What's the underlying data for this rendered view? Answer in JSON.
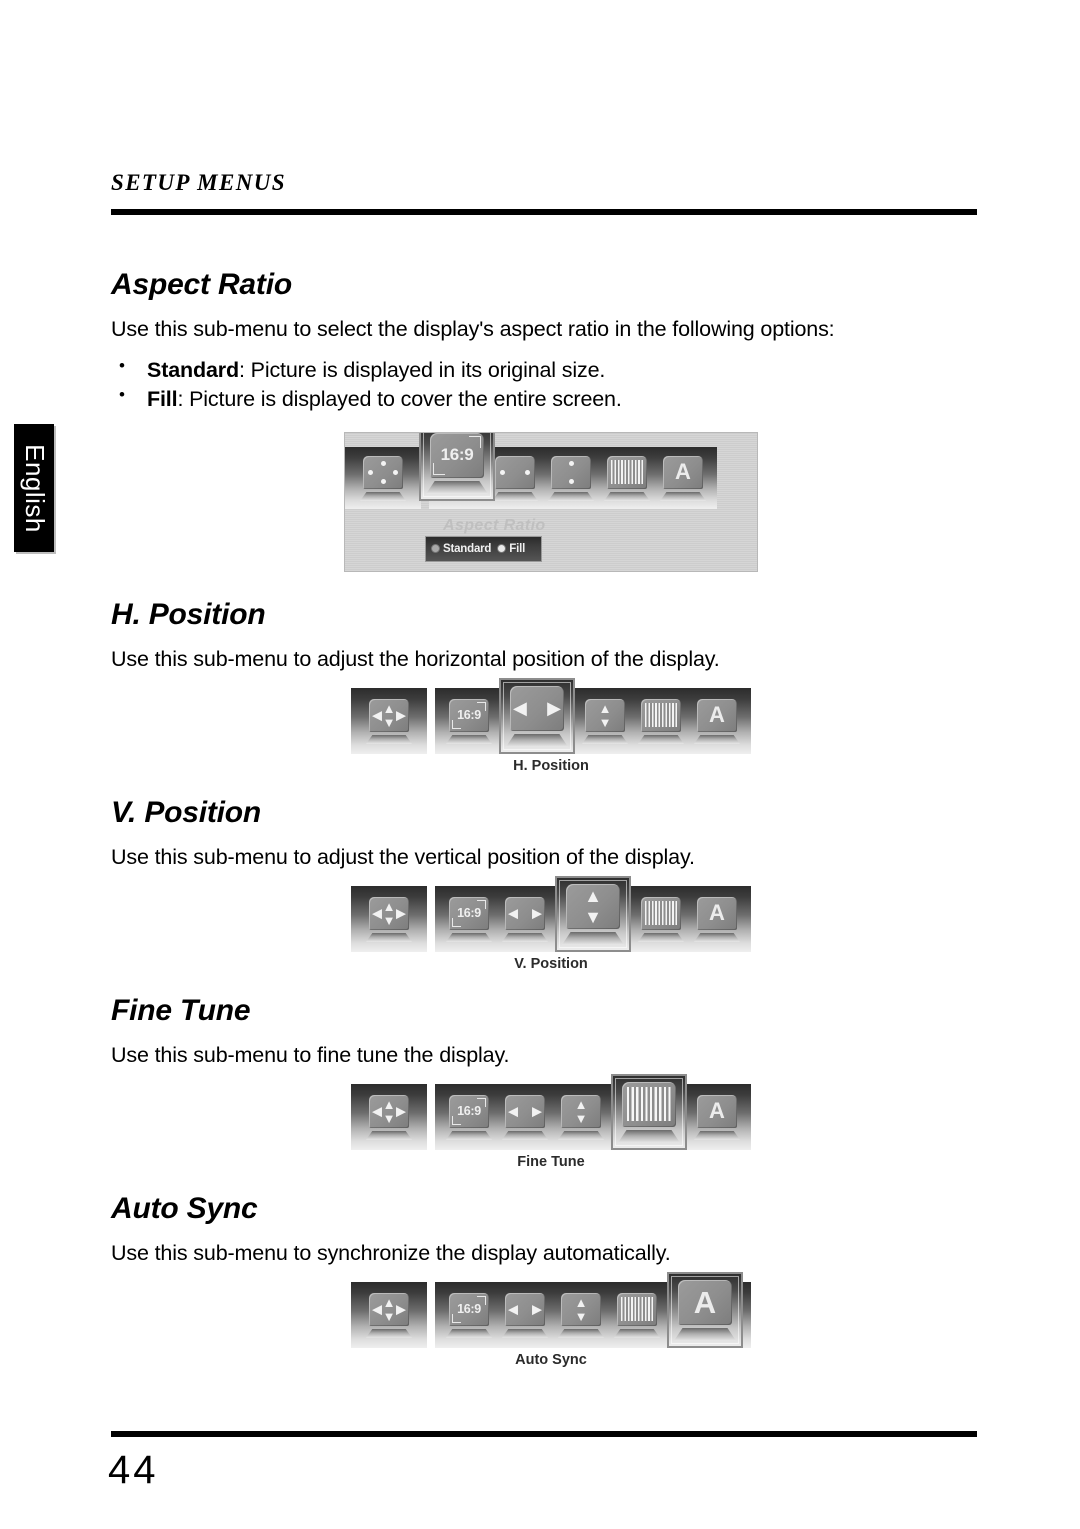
{
  "page": {
    "running_head": "SETUP MENUS",
    "page_number": "44",
    "language_tab": "English"
  },
  "sections": [
    {
      "title": "Aspect Ratio",
      "intro": "Use this sub-menu to select the display's aspect ratio in the following options:",
      "options": [
        {
          "term": "Standard",
          "desc": ": Picture is displayed in its original size."
        },
        {
          "term": "Fill",
          "desc": ": Picture is displayed to cover the entire screen."
        }
      ],
      "figure": {
        "selected": "aspect-ratio",
        "ghost_label": "Aspect Ratio",
        "radio_options": [
          {
            "label": "Standard",
            "selected": false
          },
          {
            "label": "Fill",
            "selected": true
          }
        ],
        "icons": [
          {
            "name": "four-way-arrows-icon",
            "glyph": "dots"
          },
          {
            "name": "aspect-ratio-icon",
            "glyph": "16:9"
          },
          {
            "name": "h-position-icon",
            "glyph": "left-right"
          },
          {
            "name": "v-position-icon",
            "glyph": "up-down"
          },
          {
            "name": "fine-tune-icon",
            "glyph": "bars"
          },
          {
            "name": "auto-sync-icon",
            "glyph": "A"
          }
        ]
      }
    },
    {
      "title": "H. Position",
      "intro": "Use this sub-menu to adjust the horizontal position of the display.",
      "options": [],
      "figure": {
        "selected": "h-position",
        "caption": "H. Position",
        "icons": [
          {
            "name": "four-way-arrows-icon",
            "glyph": "dots-arrows"
          },
          {
            "name": "aspect-ratio-icon",
            "glyph": "16:9"
          },
          {
            "name": "h-position-icon",
            "glyph": "left-right"
          },
          {
            "name": "v-position-icon",
            "glyph": "up-down"
          },
          {
            "name": "fine-tune-icon",
            "glyph": "bars"
          },
          {
            "name": "auto-sync-icon",
            "glyph": "A"
          }
        ]
      }
    },
    {
      "title": "V. Position",
      "intro": "Use this sub-menu to adjust the vertical position of the display.",
      "options": [],
      "figure": {
        "selected": "v-position",
        "caption": "V. Position",
        "icons": [
          {
            "name": "four-way-arrows-icon",
            "glyph": "dots-arrows"
          },
          {
            "name": "aspect-ratio-icon",
            "glyph": "16:9"
          },
          {
            "name": "h-position-icon",
            "glyph": "left-right"
          },
          {
            "name": "v-position-icon",
            "glyph": "up-down"
          },
          {
            "name": "fine-tune-icon",
            "glyph": "bars"
          },
          {
            "name": "auto-sync-icon",
            "glyph": "A"
          }
        ]
      }
    },
    {
      "title": "Fine Tune",
      "intro": "Use this sub-menu to fine tune the display.",
      "options": [],
      "figure": {
        "selected": "fine-tune",
        "caption": "Fine Tune",
        "icons": [
          {
            "name": "four-way-arrows-icon",
            "glyph": "dots-arrows"
          },
          {
            "name": "aspect-ratio-icon",
            "glyph": "16:9"
          },
          {
            "name": "h-position-icon",
            "glyph": "left-right"
          },
          {
            "name": "v-position-icon",
            "glyph": "up-down"
          },
          {
            "name": "fine-tune-icon",
            "glyph": "bars"
          },
          {
            "name": "auto-sync-icon",
            "glyph": "A"
          }
        ]
      }
    },
    {
      "title": "Auto Sync",
      "intro": "Use this sub-menu to synchronize the display automatically.",
      "options": [],
      "figure": {
        "selected": "auto-sync",
        "caption": "Auto Sync",
        "icons": [
          {
            "name": "four-way-arrows-icon",
            "glyph": "dots-arrows"
          },
          {
            "name": "aspect-ratio-icon",
            "glyph": "16:9"
          },
          {
            "name": "h-position-icon",
            "glyph": "left-right"
          },
          {
            "name": "v-position-icon",
            "glyph": "up-down"
          },
          {
            "name": "fine-tune-icon",
            "glyph": "bars"
          },
          {
            "name": "auto-sync-icon",
            "glyph": "A"
          }
        ]
      }
    }
  ],
  "glyphs": {
    "ratio_text": "16:9",
    "auto_letter": "A",
    "arrow_up": "▲",
    "arrow_down": "▼",
    "arrow_left": "◀",
    "arrow_right": "▶"
  }
}
